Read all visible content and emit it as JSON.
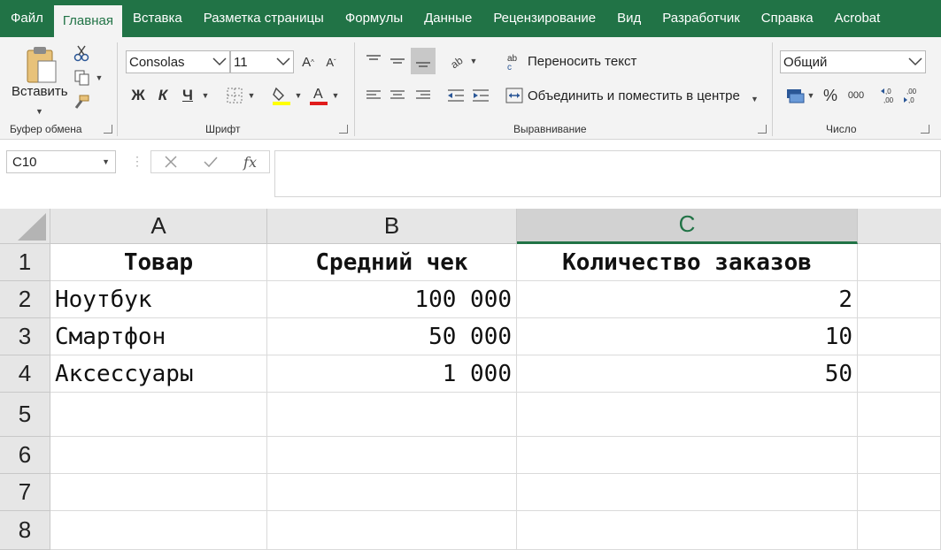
{
  "menu": {
    "tabs": [
      "Файл",
      "Главная",
      "Вставка",
      "Разметка страницы",
      "Формулы",
      "Данные",
      "Рецензирование",
      "Вид",
      "Разработчик",
      "Справка",
      "Acrobat"
    ],
    "active_index": 1
  },
  "ribbon": {
    "clipboard": {
      "paste_label": "Вставить",
      "group_label": "Буфер обмена"
    },
    "font": {
      "font_name": "Consolas",
      "font_size": "11",
      "group_label": "Шрифт",
      "bold": "Ж",
      "italic": "К",
      "underline": "Ч"
    },
    "alignment": {
      "wrap_text": "Переносить текст",
      "merge_center": "Объединить и поместить в центре",
      "group_label": "Выравнивание"
    },
    "number": {
      "format": "Общий",
      "group_label": "Число",
      "percent": "%",
      "thousands": "000"
    }
  },
  "formula_bar": {
    "name_box": "C10",
    "fx": "fx",
    "value": ""
  },
  "grid": {
    "columns": [
      "A",
      "B",
      "C"
    ],
    "selected_column": "C",
    "rows": [
      "1",
      "2",
      "3",
      "4",
      "5",
      "6",
      "7",
      "8"
    ],
    "cells": [
      [
        "Товар",
        "Средний чек",
        "Количество заказов"
      ],
      [
        "Ноутбук",
        "100 000",
        "2"
      ],
      [
        "Смартфон",
        "50 000",
        "10"
      ],
      [
        "Аксессуары",
        "1 000",
        "50"
      ]
    ]
  },
  "colors": {
    "accent": "#217346",
    "underline_red": "#e01b1b",
    "highlight_yellow": "#ffff00"
  }
}
